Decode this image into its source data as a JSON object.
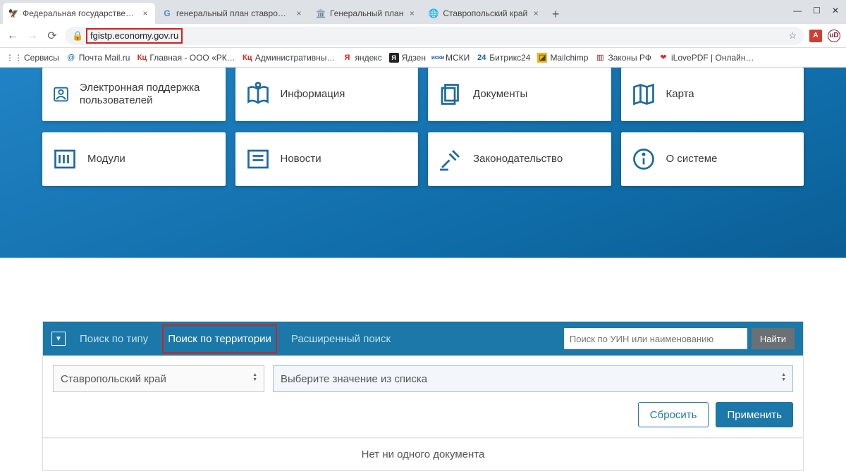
{
  "tabs": [
    {
      "label": "Федеральная государственная и"
    },
    {
      "label": "генеральный план ставропольс"
    },
    {
      "label": "Генеральный план"
    },
    {
      "label": "Ставропольский край"
    }
  ],
  "win": {
    "min": "—",
    "max": "☐",
    "close": "✕"
  },
  "nav": {
    "back": "←",
    "fwd": "→",
    "reload": "⟳"
  },
  "url": "fgistp.economy.gov.ru",
  "star": "☆",
  "ext": {
    "adobe": "A",
    "ublock": "uD"
  },
  "bookmarks": [
    {
      "icon": "⋮⋮",
      "label": "Сервисы"
    },
    {
      "icon": "@",
      "label": "Почта Mail.ru",
      "col": "#1268b3"
    },
    {
      "icon": "Кц",
      "label": "Главная - ООО «РК…",
      "col": "#cf3223"
    },
    {
      "icon": "Кц",
      "label": "Административны…",
      "col": "#cf3223"
    },
    {
      "icon": "Я",
      "label": "яндекс",
      "col": "#e22"
    },
    {
      "icon": "Я",
      "label": "Ядзен",
      "col": "#222"
    },
    {
      "icon": "иски",
      "label": "МСКИ",
      "col": "#1a5aa5"
    },
    {
      "icon": "24",
      "label": "Битрикс24",
      "col": "#1264a5"
    },
    {
      "icon": "◪",
      "label": "Mailchimp",
      "col": "#f5b50a"
    },
    {
      "icon": "▥",
      "label": "Законы РФ",
      "col": "#7a2219"
    },
    {
      "icon": "❤",
      "label": "iLovePDF | Онлайн…",
      "col": "#e02a2a"
    }
  ],
  "cards_row1": [
    {
      "label": "Электронная поддержка пользователей",
      "icon": "user"
    },
    {
      "label": "Информация",
      "icon": "info"
    },
    {
      "label": "Документы",
      "icon": "docs"
    },
    {
      "label": "Карта",
      "icon": "map"
    }
  ],
  "cards_row2": [
    {
      "label": "Модули",
      "icon": "modules"
    },
    {
      "label": "Новости",
      "icon": "news"
    },
    {
      "label": "Законодательство",
      "icon": "law"
    },
    {
      "label": "О системе",
      "icon": "about"
    }
  ],
  "search": {
    "toggle": "▼",
    "tabs": [
      {
        "label": "Поиск по типу",
        "active": false
      },
      {
        "label": "Поиск по территории",
        "active": true
      },
      {
        "label": "Расширенный поиск",
        "active": false
      }
    ],
    "input_placeholder": "Поиск по УИН или наименованию",
    "find": "Найти",
    "select1": "Ставропольский край",
    "select2": "Выберите значение из списка",
    "reset": "Сбросить",
    "apply": "Применить",
    "empty": "Нет ни одного документа"
  }
}
